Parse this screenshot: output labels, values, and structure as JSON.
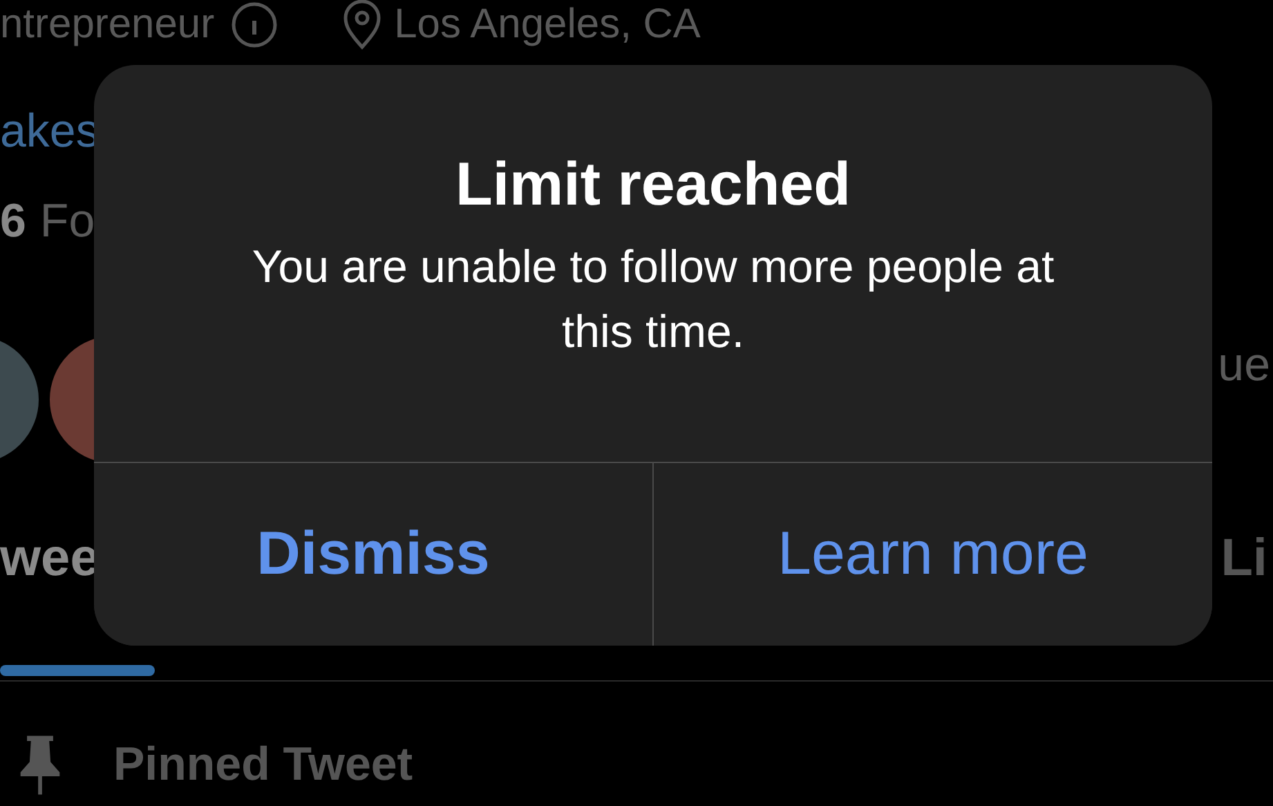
{
  "profile": {
    "occupation": "ntrepreneur",
    "location": "Los Angeles, CA",
    "website": "akes",
    "following_count": "6",
    "following_label": "Fo",
    "side_text": "ue"
  },
  "tabs": [
    {
      "label": "wee",
      "selected": true
    },
    {
      "label": "Li",
      "selected": false
    }
  ],
  "pinned": {
    "label": "Pinned Tweet"
  },
  "dialog": {
    "title": "Limit reached",
    "message": "You are unable to follow more people at this time.",
    "buttons": [
      {
        "label": "Dismiss",
        "bold": true
      },
      {
        "label": "Learn more",
        "bold": false
      }
    ]
  }
}
